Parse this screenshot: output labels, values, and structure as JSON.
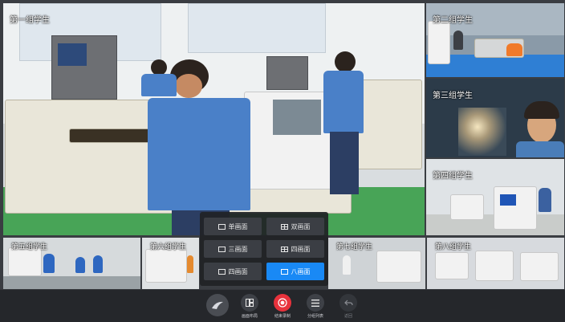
{
  "tiles": {
    "main": {
      "label": "第一组学生"
    },
    "right": [
      {
        "label": "第二组学生"
      },
      {
        "label": "第三组学生"
      },
      {
        "label": "第四组学生"
      }
    ],
    "bottom": [
      {
        "label": "第五组学生"
      },
      {
        "label": "第六组学生"
      },
      {
        "label": "第七组学生"
      },
      {
        "label": "第八组学生"
      }
    ]
  },
  "layout_menu": {
    "options": [
      {
        "label": "单画面",
        "active": false
      },
      {
        "label": "双画面",
        "active": false
      },
      {
        "label": "三画面",
        "active": false
      },
      {
        "label": "四画面",
        "active": false
      },
      {
        "label": "四画面",
        "active": false
      },
      {
        "label": "八画面",
        "active": true
      }
    ],
    "accent_color": "#1989f5"
  },
  "toolbar": {
    "buttons": [
      {
        "label": "",
        "icon": "logo-icon"
      },
      {
        "label": "画面布局",
        "icon": "layout-icon"
      },
      {
        "label": "结束录制",
        "icon": "record-icon",
        "color": "#e8323c"
      },
      {
        "label": "分组列表",
        "icon": "list-icon"
      },
      {
        "label": "返回",
        "icon": "back-icon"
      }
    ]
  }
}
